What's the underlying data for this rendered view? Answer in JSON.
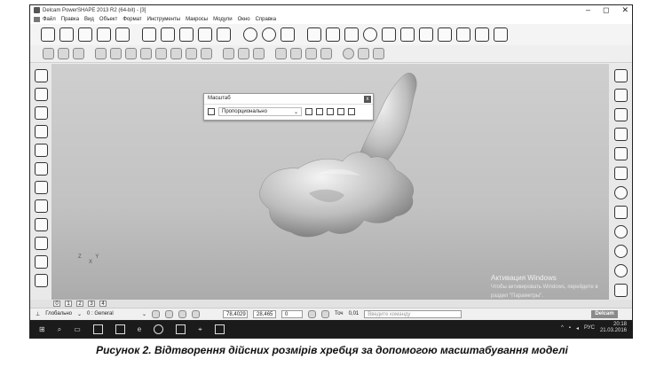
{
  "window": {
    "title": "Delcam PowerSHAPE 2013 R2 (64-bit) - [3]",
    "controls": [
      "–",
      "◻",
      "✕"
    ]
  },
  "menu": [
    "Файл",
    "Правка",
    "Вид",
    "Объект",
    "Формат",
    "Инструменты",
    "Макросы",
    "Модули",
    "Окно",
    "Справка"
  ],
  "scale_dialog": {
    "title": "Масштаб",
    "mode": "Пропорционально",
    "close": "x"
  },
  "view_tabs": [
    "0",
    "1",
    "2",
    "3",
    "4"
  ],
  "axes": {
    "x": "X",
    "y": "Y",
    "z": "Z"
  },
  "status": {
    "workplane": "Глобально",
    "level": "0 : General",
    "coord_x": "78,4029",
    "coord_y": "28,465",
    "coord_z": "0",
    "tolerance_label": "Точ",
    "tolerance": "0,01",
    "command_placeholder": "Введите команду",
    "brand": "Delcam"
  },
  "activation": {
    "line1": "Активация Windows",
    "line2": "Чтобы активировать Windows, перейдите в",
    "line3": "раздел \"Параметры\"."
  },
  "taskbar": {
    "lang": "РУС",
    "time": "20:18",
    "date": "21.03.2016"
  },
  "caption": "Рисунок 2. Відтворення дійсних розмірів хребця за допомогою масштабування моделі"
}
